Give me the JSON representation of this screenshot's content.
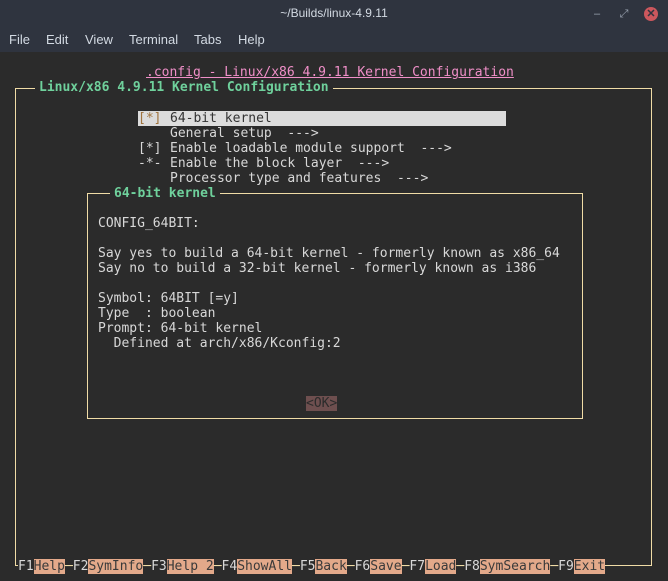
{
  "window": {
    "title": "~/Builds/linux-4.9.11",
    "minimize": "–",
    "maximize": "⤢",
    "close": "✕"
  },
  "menu": [
    "File",
    "Edit",
    "View",
    "Terminal",
    "Tabs",
    "Help"
  ],
  "header": {
    "title": ".config - Linux/x86 4.9.11 Kernel Configuration"
  },
  "main": {
    "title": "Linux/x86 4.9.11 Kernel Configuration",
    "items": [
      {
        "mark": "[*]",
        "label": "64-bit kernel",
        "selected": true
      },
      {
        "mark": "",
        "label": "General setup  --->"
      },
      {
        "mark": "[*]",
        "label": "Enable loadable module support  --->"
      },
      {
        "mark": "-*-",
        "label": "Enable the block layer  --->"
      },
      {
        "mark": "",
        "label": "Processor type and features  --->"
      }
    ]
  },
  "dialog": {
    "title": "64-bit kernel",
    "lines": [
      "CONFIG_64BIT:",
      "",
      "Say yes to build a 64-bit kernel - formerly known as x86_64",
      "Say no to build a 32-bit kernel - formerly known as i386",
      "",
      "Symbol: 64BIT [=y]",
      "Type  : boolean",
      "Prompt: 64-bit kernel",
      "  Defined at arch/x86/Kconfig:2"
    ],
    "ok": "<OK>"
  },
  "fkeys": [
    {
      "key": "F1",
      "label": "Help"
    },
    {
      "key": "F2",
      "label": "SymInfo"
    },
    {
      "key": "F3",
      "label": "Help 2"
    },
    {
      "key": "F4",
      "label": "ShowAll"
    },
    {
      "key": "F5",
      "label": "Back"
    },
    {
      "key": "F6",
      "label": "Save"
    },
    {
      "key": "F7",
      "label": "Load"
    },
    {
      "key": "F8",
      "label": "SymSearch"
    },
    {
      "key": "F9",
      "label": "Exit"
    }
  ],
  "colors": {
    "accent_green": "#6fd19c",
    "title_pink": "#f08fc8",
    "border": "#f0dca6",
    "key_highlight": "#e3a98a"
  }
}
